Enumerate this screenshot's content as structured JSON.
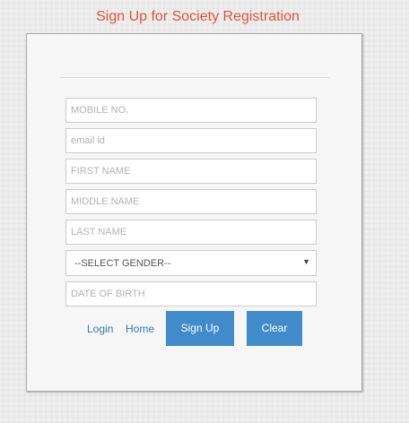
{
  "page": {
    "title": "Sign Up for Society Registration"
  },
  "form": {
    "mobile_placeholder": "MOBILE NO.",
    "email_placeholder": "email id",
    "first_name_placeholder": "FIRST NAME",
    "middle_name_placeholder": "MIDDLE NAME",
    "last_name_placeholder": "LAST NAME",
    "gender_selected": "--SELECT GENDER--",
    "dob_placeholder": "DATE OF BIRTH"
  },
  "actions": {
    "login_label": "Login",
    "home_label": "Home",
    "signup_label": "Sign Up",
    "clear_label": "Clear"
  },
  "icons": {
    "dropdown": "chevron-down-icon"
  },
  "colors": {
    "title": "#e0533d",
    "button": "#428bca",
    "link": "#337ab7"
  }
}
